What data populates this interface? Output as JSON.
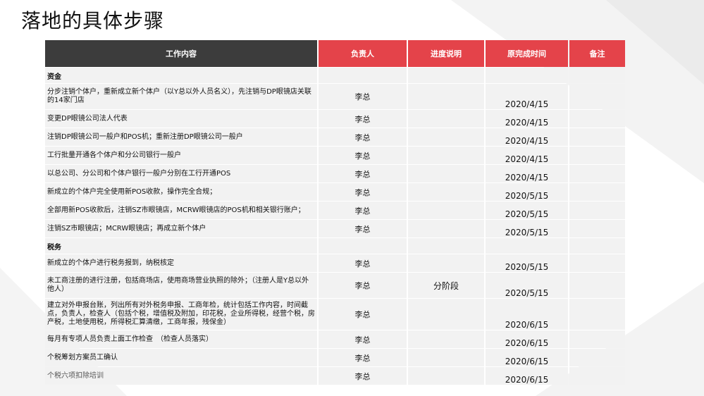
{
  "title": "落地的具体步骤",
  "headers": {
    "task": "工作内容",
    "owner": "负责人",
    "progress": "进度说明",
    "date": "原完成时间",
    "note": "备注"
  },
  "sections": {
    "funds": "资金",
    "tax": "税务"
  },
  "rows": [
    {
      "task": "分步注销个体户，重新成立新个体户（以Y总以外人员名义），先注销与DP眼镜店关联的14家门店",
      "owner": "李总",
      "progress": "",
      "date": "2020/4/15",
      "note": ""
    },
    {
      "task": "变更DP眼镜公司法人代表",
      "owner": "李总",
      "progress": "",
      "date": "2020/4/15",
      "note": ""
    },
    {
      "task": "注销DP眼镜公司一般户和POS机；重新注册DP眼镜公司一般户",
      "owner": "李总",
      "progress": "",
      "date": "2020/4/15",
      "note": ""
    },
    {
      "task": "工行批量开通各个体户和分公司银行一般户",
      "owner": "李总",
      "progress": "",
      "date": "2020/4/15",
      "note": ""
    },
    {
      "task": "以总公司、分公司和个体户银行一般户分别在工行开通POS",
      "owner": "李总",
      "progress": "",
      "date": "2020/4/15",
      "note": ""
    },
    {
      "task": "新成立的个体户完全使用新POS收款，操作完全合规；",
      "owner": "李总",
      "progress": "",
      "date": "2020/5/15",
      "note": ""
    },
    {
      "task": "全部用新POS收款后，注销SZ市眼镜店，MCRW眼镜店的POS机和相关银行账户；",
      "owner": "李总",
      "progress": "",
      "date": "2020/5/15",
      "note": ""
    },
    {
      "task": "注销SZ市眼镜店；MCRW眼镜店；再成立新个体户",
      "owner": "李总",
      "progress": "",
      "date": "2020/5/15",
      "note": ""
    },
    {
      "task": "新成立的个体户进行税务报到，纳税核定",
      "owner": "李总",
      "progress": "",
      "date": "2020/5/15",
      "note": ""
    },
    {
      "task": "未工商注册的进行注册，包括商场店，使用商场营业执照的除外；（注册人是Y总以外他人）",
      "owner": "李总",
      "progress": "分阶段",
      "date": "2020/5/15",
      "note": ""
    },
    {
      "task": "建立对外申报台账，列出所有对外税务申报、工商年检，统计包括工作内容，时间截点，负责人，检查人（包括个税，增值税及附加，印花税，企业所得税，经营个税，房产税，土地使用税，所得税汇算清缴，工商年报，残保金）",
      "owner": "李总",
      "progress": "",
      "date": "2020/6/15",
      "note": ""
    },
    {
      "task": "每月有专项人员负责上面工作检查　（检查人员落实）",
      "owner": "李总",
      "progress": "",
      "date": "2020/6/15",
      "note": ""
    },
    {
      "task": "个税筹划方案员工确认",
      "owner": "李总",
      "progress": "",
      "date": "2020/6/15",
      "note": ""
    },
    {
      "task": "个税六项扣除培训",
      "owner": "李总",
      "progress": "",
      "date": "2020/6/15",
      "note": ""
    }
  ]
}
